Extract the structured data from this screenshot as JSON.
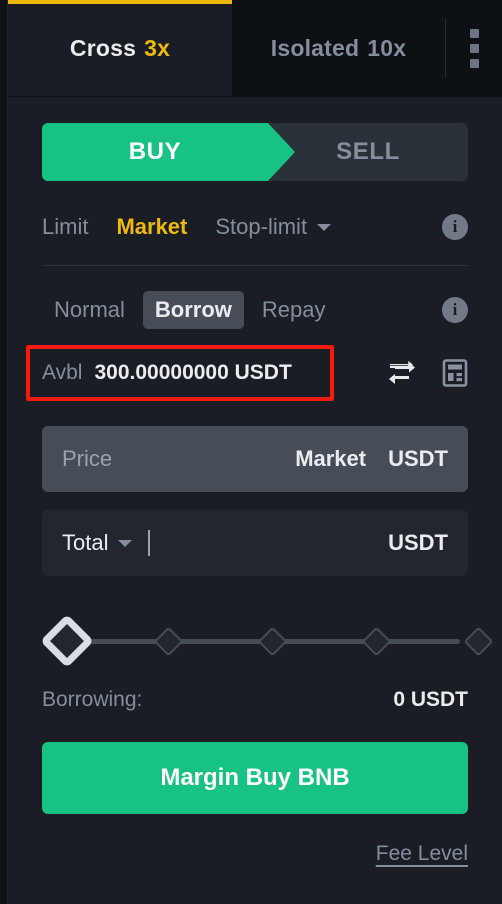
{
  "margin_tabs": [
    {
      "name": "Cross",
      "leverage": "3x",
      "selected": true
    },
    {
      "name": "Isolated",
      "leverage": "10x",
      "selected": false
    }
  ],
  "kebab_menu": {
    "name": "more-options"
  },
  "side_toggle": {
    "buy_label": "BUY",
    "sell_label": "SELL",
    "selected": "BUY",
    "buy_color": "#18c283",
    "sell_bg": "#2b3139"
  },
  "order_types": {
    "items": [
      "Limit",
      "Market",
      "Stop-limit"
    ],
    "selected": "Market",
    "accent": "#f0b90b",
    "info_label": "i"
  },
  "borrow_modes": {
    "items": [
      "Normal",
      "Borrow",
      "Repay"
    ],
    "selected": "Borrow",
    "info_label": "i"
  },
  "available": {
    "label": "Avbl",
    "value": "300.00000000 USDT",
    "highlight_color": "#f81a0a",
    "transfer_icon": "transfer-icon",
    "calculator_icon": "calculator-icon"
  },
  "price_field": {
    "placeholder": "Price",
    "market_label": "Market",
    "unit": "USDT",
    "disabled": true
  },
  "total_field": {
    "label": "Total",
    "value": "",
    "unit": "USDT"
  },
  "amount_slider": {
    "value": 0,
    "min": 0,
    "max": 100,
    "steps": [
      0,
      25,
      50,
      75,
      100
    ]
  },
  "borrowing": {
    "label": "Borrowing:",
    "value": "0 USDT"
  },
  "submit": {
    "label": "Margin Buy BNB",
    "color": "#18c283"
  },
  "fee_level": {
    "label": "Fee Level"
  }
}
